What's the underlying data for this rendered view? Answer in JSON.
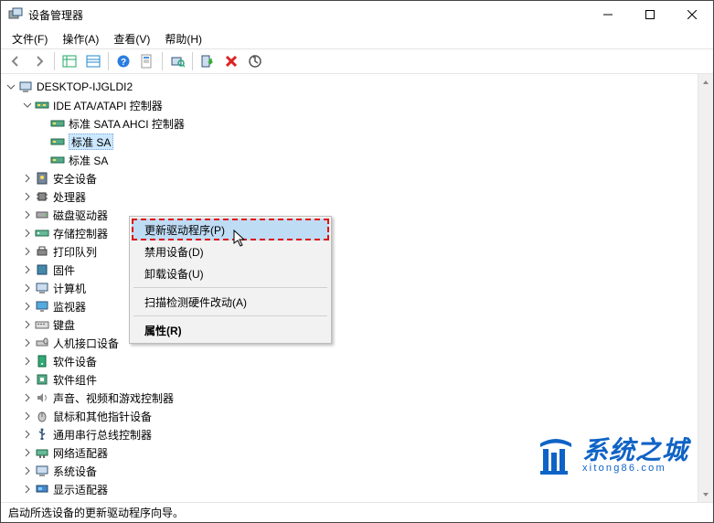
{
  "window": {
    "title": "设备管理器"
  },
  "menu": {
    "file": "文件(F)",
    "action": "操作(A)",
    "view": "查看(V)",
    "help": "帮助(H)"
  },
  "toolbar_icons": {
    "back": "back-icon",
    "forward": "forward-icon",
    "show": "show-icon",
    "details": "details-icon",
    "help": "help-icon",
    "props": "props-icon",
    "refresh": "refresh-icon",
    "scan": "scan-icon",
    "enable": "enable-icon",
    "remove": "remove-icon",
    "update": "update-icon"
  },
  "tree": {
    "root": "DESKTOP-IJGLDI2",
    "ide": "IDE ATA/ATAPI 控制器",
    "ide_child1": "标准 SATA AHCI 控制器",
    "ide_child2": "标准 SA",
    "ide_child3": "标准 SA",
    "security": "安全设备",
    "cpu": "处理器",
    "disk": "磁盘驱动器",
    "storage": "存储控制器",
    "printq": "打印队列",
    "firmware": "固件",
    "computer": "计算机",
    "monitor": "监视器",
    "keyboard": "键盘",
    "hid": "人机接口设备",
    "swdev": "软件设备",
    "swcomp": "软件组件",
    "audio": "声音、视频和游戏控制器",
    "mouse": "鼠标和其他指针设备",
    "usb": "通用串行总线控制器",
    "network": "网络适配器",
    "system": "系统设备",
    "display": "显示适配器"
  },
  "context_menu": {
    "update": "更新驱动程序(P)",
    "disable": "禁用设备(D)",
    "uninstall": "卸载设备(U)",
    "scan": "扫描检测硬件改动(A)",
    "props": "属性(R)"
  },
  "statusbar": {
    "text": "启动所选设备的更新驱动程序向导。"
  },
  "watermark": {
    "main": "系统之城",
    "sub": "xitong86.com"
  }
}
